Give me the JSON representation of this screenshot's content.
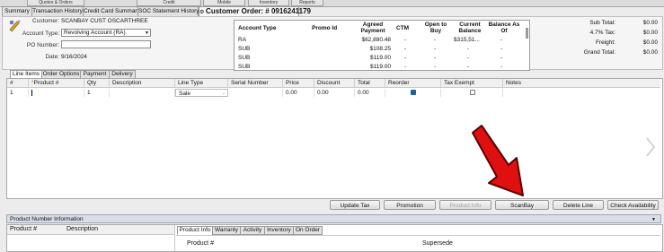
{
  "top_tabs": [
    "Quotes & Orders",
    "Credit",
    "Mobile",
    "Inventory",
    "Reports"
  ],
  "tabs": [
    "Summary",
    "Transaction History",
    "Credit Card Summary",
    "SOC Statement History"
  ],
  "active_tab": "Customer Order: # 0916241179",
  "header": {
    "customer_label": "Customer:",
    "customer_value": "SCANBAY CUST OSCARTHREE",
    "account_type_label": "Account Type:",
    "account_type_value": "Revolving Account (RA)",
    "po_label": "PO Number:",
    "po_value": "",
    "date_label": "Date:",
    "date_value": "9/16/2024"
  },
  "accounts": {
    "columns": [
      "Account Type",
      "Promo Id",
      "Agreed Payment",
      "CTM",
      "Open to Buy",
      "Current Balance",
      "Balance As Of"
    ],
    "rows": [
      [
        "RA",
        "",
        "$62,880.48",
        "-",
        "-",
        "$315,51...",
        "-"
      ],
      [
        "SUB",
        "",
        "$108.25",
        "-",
        "-",
        "-",
        "-"
      ],
      [
        "SUB",
        "",
        "$119.00",
        "-",
        "-",
        "-",
        "-"
      ],
      [
        "SUB",
        "",
        "$119.00",
        "-",
        "-",
        "-",
        "-"
      ]
    ]
  },
  "totals": {
    "subtotal_label": "Sub Total:",
    "subtotal": "$0.00",
    "tax_label": "4.7% Tax:",
    "tax": "$0.00",
    "freight_label": "Freight:",
    "freight": "$0.00",
    "grand_label": "Grand Total:",
    "grand": "$0.00"
  },
  "line_tabs": [
    "Line Items",
    "Order Options",
    "Payment",
    "Delivery"
  ],
  "grid": {
    "columns": [
      "#",
      "Product #",
      "Qty",
      "Description",
      "Line Type",
      "Serial Number",
      "Price",
      "Discount",
      "Total",
      "Reorder",
      "Tax Exempt",
      "Notes"
    ],
    "row": {
      "num": "1",
      "product": "",
      "qty": "1",
      "description": "",
      "line_type": "Sale",
      "serial": "",
      "price": "0.00",
      "discount": "0.00",
      "total": "0.00",
      "reorder": true,
      "tax_exempt": false,
      "notes": ""
    }
  },
  "buttons": [
    "Update Tax",
    "Promotion",
    "Product Info",
    "ScanBay",
    "Delete Line",
    "Check Availability"
  ],
  "disabled_button": "Product Info",
  "product_info": {
    "section_title": "Product Number Information",
    "columns": [
      "Product #",
      "Description"
    ],
    "tabs": [
      "Product Info",
      "Warranty",
      "Activity",
      "Inventory",
      "On Order"
    ],
    "product_label": "Product #",
    "supersede_label": "Supersede"
  },
  "colors": {
    "arrow": "#e01010",
    "selected_tab_bg": "#f7f7f7",
    "panel_header": "#d9dde6"
  }
}
